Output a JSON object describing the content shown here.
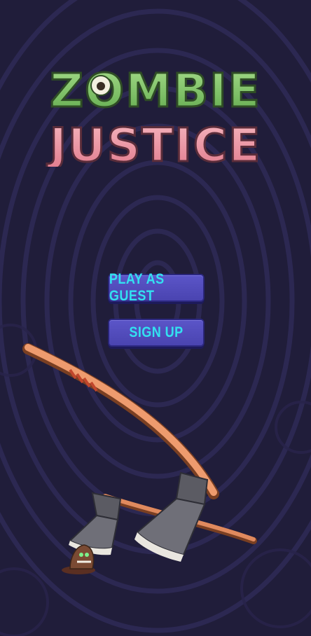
{
  "title": {
    "line1": "ZOMBIE",
    "line2": "JUSTICE"
  },
  "buttons": {
    "guest_label": "PLAY AS GUEST",
    "signup_label": "SIGN UP"
  },
  "colors": {
    "background": "#201d3a",
    "rings": "#2b2750",
    "button_fill": "#4f49bb",
    "button_text": "#33e0f0",
    "logo_green": "#7fc66a",
    "logo_pink": "#f19aa8"
  },
  "icons": [
    "axe-icon",
    "zombie-hand-icon",
    "bitcoin-coin-icon"
  ]
}
